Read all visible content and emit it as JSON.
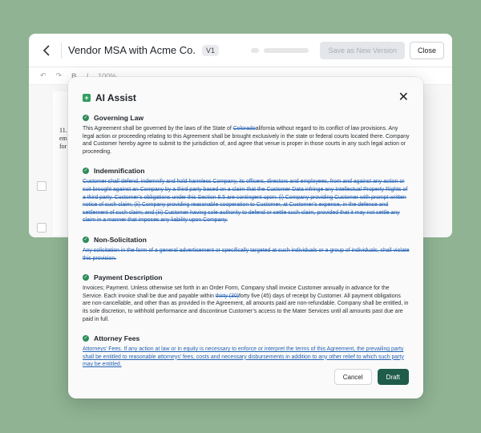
{
  "editor": {
    "title": "Vendor MSA with Acme Co.",
    "version": "V1",
    "save_label": "Save as New Version",
    "close_label": "Close",
    "zoom": "100%",
    "page_text": [
      "11.",
      "em",
      "for"
    ]
  },
  "modal": {
    "title": "AI Assist",
    "close_glyph": "✕",
    "sections": [
      {
        "title": "Governing Law",
        "parts": [
          {
            "t": "This Agreement shall be governed by the laws of the State of "
          },
          {
            "t": "Colorado",
            "style": "del"
          },
          {
            "t": "alifornia without regard to its conflict of law provisions. Any legal action or proceeding relating to this Agreement shall be brought exclusively in the state or federal courts located there. Company and Customer hereby agree to submit to the jurisdiction of, and agree that venue is proper in those courts in any such legal action or proceeding."
          }
        ]
      },
      {
        "title": "Indemnification",
        "parts": [
          {
            "t": "Customer shall defend, indemnify and hold harmless Company, its officers, directors and employees, from and against any action or suit brought against an Company by a third party based on a claim that the Customer Data infringe any Intellectual Property Rights of a third party. Customer’s obligations under this Section 8.5 are contingent upon: (i) Company providing Customer with prompt written notice of such claim; (ii) Company providing reasonable cooperation to Customer, at Customer’s expense, in the defense and settlement of such claim; and (iii) Customer having sole authority to defend or settle such claim, provided that it may not settle any claim in a manner that imposes any liability upon Company.",
            "style": "del"
          }
        ]
      },
      {
        "title": "Non-Solicitation",
        "parts": [
          {
            "t": "Any solicitation in the form of a general advertisement or specifically targeted at such individuals or a group of individuals, shall violate this provision.",
            "style": "del"
          }
        ]
      },
      {
        "title": "Payment Description",
        "parts": [
          {
            "t": "Invoices; Payment. Unless otherwise set forth in an Order Form, Company shall invoice Customer annually in advance for the Service. Each invoice shall be due and payable within "
          },
          {
            "t": "thirty (30)",
            "style": "del"
          },
          {
            "t": "forty five (45) days of receipt by Customer. All payment obligations are non-cancellable, and other than as provided in the Agreement, all amounts paid are non-refundable. Company shall be entitled, in its sole discretion, to withhold performance and discontinue Customer’s access to the Mater Services until all amounts past due are paid in full."
          }
        ]
      },
      {
        "title": "Attorney Fees",
        "parts": [
          {
            "t": "Attorneys’ Fees. If any action at law or in equity is necessary to enforce or interpret the terms of this Agreement, the prevailing party shall be entitled to reasonable attorneys’ fees, costs and necessary disbursements in addition to any other relief to which such party may be entitled.",
            "style": "ins"
          }
        ]
      }
    ],
    "cancel_label": "Cancel",
    "draft_label": "Draft"
  }
}
